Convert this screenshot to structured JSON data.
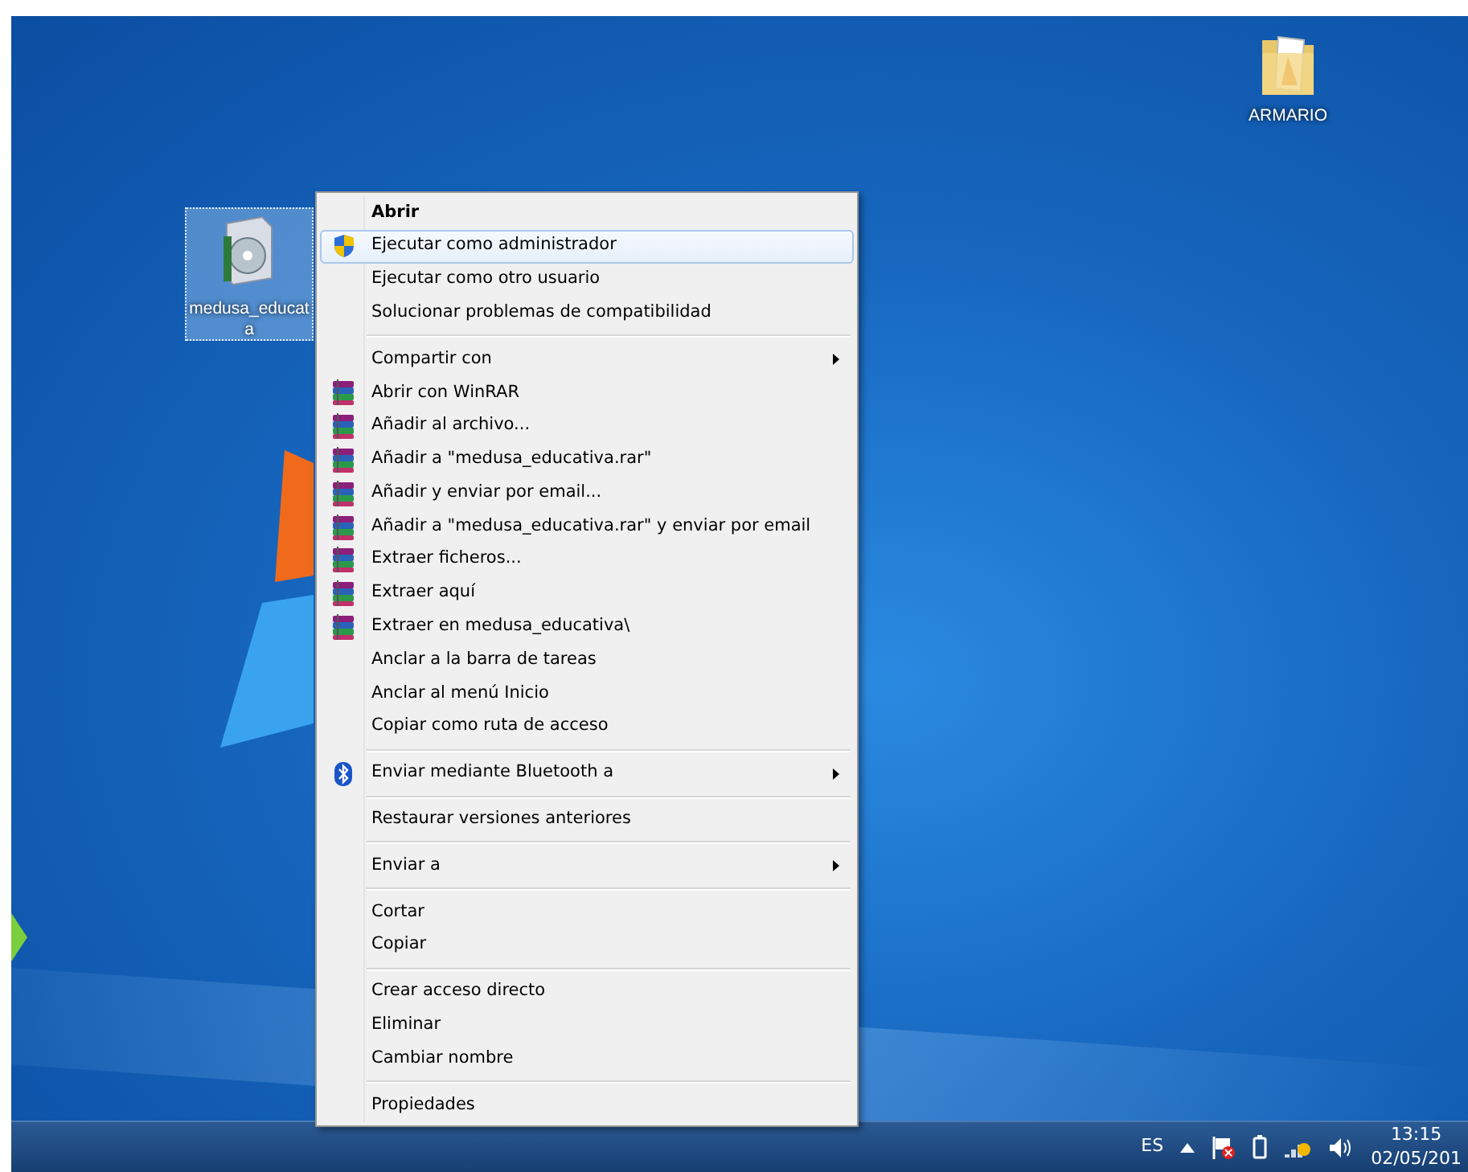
{
  "desktop_icons": [
    {
      "kind": "installer",
      "label_lines": [
        "medusa_educat",
        "a"
      ],
      "selected": true
    },
    {
      "kind": "folder",
      "label_lines": [
        "ARMARIO"
      ],
      "selected": false
    }
  ],
  "context_menu": {
    "groups": [
      [
        {
          "label": "Abrir",
          "kind": "plain",
          "bold": true,
          "submenu": false,
          "selected": false
        },
        {
          "label": "Ejecutar como administrador",
          "kind": "shield",
          "bold": false,
          "submenu": false,
          "selected": true
        },
        {
          "label": "Ejecutar como otro usuario",
          "kind": "plain",
          "bold": false,
          "submenu": false,
          "selected": false
        },
        {
          "label": "Solucionar problemas de compatibilidad",
          "kind": "plain",
          "bold": false,
          "submenu": false,
          "selected": false
        }
      ],
      [
        {
          "label": "Compartir con",
          "kind": "plain",
          "bold": false,
          "submenu": true,
          "selected": false
        },
        {
          "label": "Abrir con WinRAR",
          "kind": "archive",
          "bold": false,
          "submenu": false,
          "selected": false
        },
        {
          "label": "Añadir al archivo...",
          "kind": "archive",
          "bold": false,
          "submenu": false,
          "selected": false
        },
        {
          "label": "Añadir a \"medusa_educativa.rar\"",
          "kind": "archive",
          "bold": false,
          "submenu": false,
          "selected": false
        },
        {
          "label": "Añadir y enviar por email...",
          "kind": "archive",
          "bold": false,
          "submenu": false,
          "selected": false
        },
        {
          "label": "Añadir a \"medusa_educativa.rar\" y enviar por email",
          "kind": "archive",
          "bold": false,
          "submenu": false,
          "selected": false
        },
        {
          "label": "Extraer ficheros...",
          "kind": "archive",
          "bold": false,
          "submenu": false,
          "selected": false
        },
        {
          "label": "Extraer aquí",
          "kind": "archive",
          "bold": false,
          "submenu": false,
          "selected": false
        },
        {
          "label": "Extraer en medusa_educativa\\",
          "kind": "archive",
          "bold": false,
          "submenu": false,
          "selected": false
        },
        {
          "label": "Anclar a la barra de tareas",
          "kind": "plain",
          "bold": false,
          "submenu": false,
          "selected": false
        },
        {
          "label": "Anclar al menú Inicio",
          "kind": "plain",
          "bold": false,
          "submenu": false,
          "selected": false
        },
        {
          "label": "Copiar como ruta de acceso",
          "kind": "plain",
          "bold": false,
          "submenu": false,
          "selected": false
        }
      ],
      [
        {
          "label": "Enviar mediante Bluetooth a",
          "kind": "bluetooth",
          "bold": false,
          "submenu": true,
          "selected": false
        }
      ],
      [
        {
          "label": "Restaurar versiones anteriores",
          "kind": "plain",
          "bold": false,
          "submenu": false,
          "selected": false
        }
      ],
      [
        {
          "label": "Enviar a",
          "kind": "plain",
          "bold": false,
          "submenu": true,
          "selected": false
        }
      ],
      [
        {
          "label": "Cortar",
          "kind": "plain",
          "bold": false,
          "submenu": false,
          "selected": false
        },
        {
          "label": "Copiar",
          "kind": "plain",
          "bold": false,
          "submenu": false,
          "selected": false
        }
      ],
      [
        {
          "label": "Crear acceso directo",
          "kind": "plain",
          "bold": false,
          "submenu": false,
          "selected": false
        },
        {
          "label": "Eliminar",
          "kind": "plain",
          "bold": false,
          "submenu": false,
          "selected": false
        },
        {
          "label": "Cambiar nombre",
          "kind": "plain",
          "bold": false,
          "submenu": false,
          "selected": false
        }
      ],
      [
        {
          "label": "Propiedades",
          "kind": "plain",
          "bold": false,
          "submenu": false,
          "selected": false
        }
      ]
    ]
  },
  "taskbar": {
    "language": "ES",
    "time": "13:15",
    "date": "02/05/201"
  }
}
